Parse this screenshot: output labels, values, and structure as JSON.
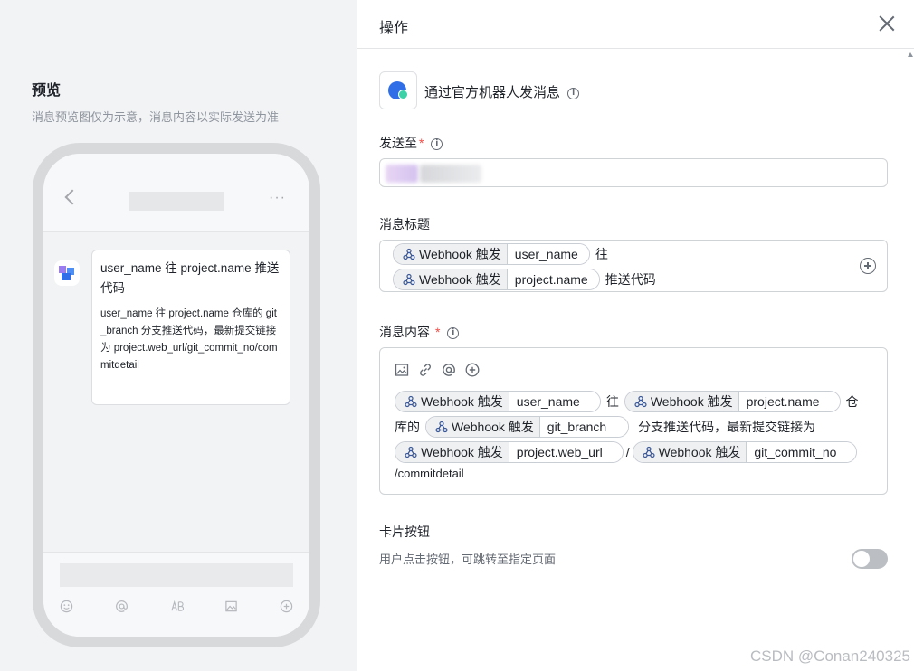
{
  "preview": {
    "title": "预览",
    "subtitle": "消息预览图仅为示意，消息内容以实际发送为准",
    "more_icon": "···",
    "bubble_title": "user_name 往 project.name 推送代码",
    "bubble_content": "user_name 往 project.name 仓库的 git_branch  分支推送代码，最新提交链接为 project.web_url/git_commit_no/commitdetail",
    "input_icons": [
      "emoji-icon",
      "at-icon",
      "text-icon",
      "image-icon",
      "plus-icon"
    ]
  },
  "drawer": {
    "title": "操作",
    "bot_label": "通过官方机器人发消息",
    "send_to_label": "发送至",
    "required_mark": "*",
    "info_glyph": "i",
    "msg_title_label": "消息标题",
    "msg_content_label": "消息内容",
    "card_button_label": "卡片按钮",
    "card_button_desc": "用户点击按钮，可跳转至指定页面",
    "card_button_enabled": false
  },
  "title_field": {
    "tags": [
      {
        "source": "Webhook 触发",
        "var": "user_name",
        "after": "往"
      },
      {
        "source": "Webhook 触发",
        "var": "project.name",
        "after": "推送代码"
      }
    ]
  },
  "content_field": {
    "toolbar": [
      "image-icon",
      "link-icon",
      "at-icon",
      "add-icon"
    ],
    "text_1": "往",
    "text_2a": "仓",
    "text_2b": "库的",
    "text_3": "分支推送代码，最新提交链接为",
    "text_4": "/",
    "text_5": "/commitdetail",
    "tags": [
      {
        "source": "Webhook 触发",
        "var": "user_name"
      },
      {
        "source": "Webhook 触发",
        "var": "project.name"
      },
      {
        "source": "Webhook 触发",
        "var": "git_branch"
      },
      {
        "source": "Webhook 触发",
        "var": "project.web_url"
      },
      {
        "source": "Webhook 触发",
        "var": "git_commit_no"
      }
    ]
  },
  "watermark": "CSDN @Conan240325"
}
